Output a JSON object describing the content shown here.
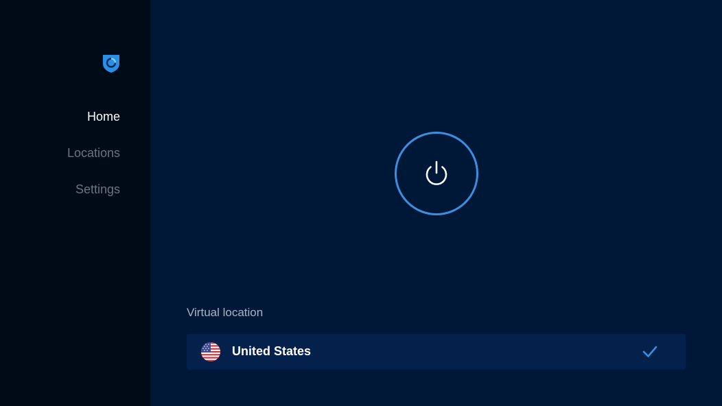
{
  "sidebar": {
    "logo_icon": "hotspot-shield-logo",
    "items": [
      {
        "label": "Home",
        "active": true
      },
      {
        "label": "Locations",
        "active": false
      },
      {
        "label": "Settings",
        "active": false
      }
    ]
  },
  "main": {
    "power_icon": "power-icon",
    "section_label": "Virtual location",
    "location": {
      "name": "United States",
      "flag_icon": "us-flag-icon",
      "selected_icon": "checkmark-icon"
    }
  },
  "colors": {
    "background": "#001838",
    "sidebar_background": "#000b18",
    "accent": "#3b8fe0",
    "row_background": "#03214a"
  }
}
